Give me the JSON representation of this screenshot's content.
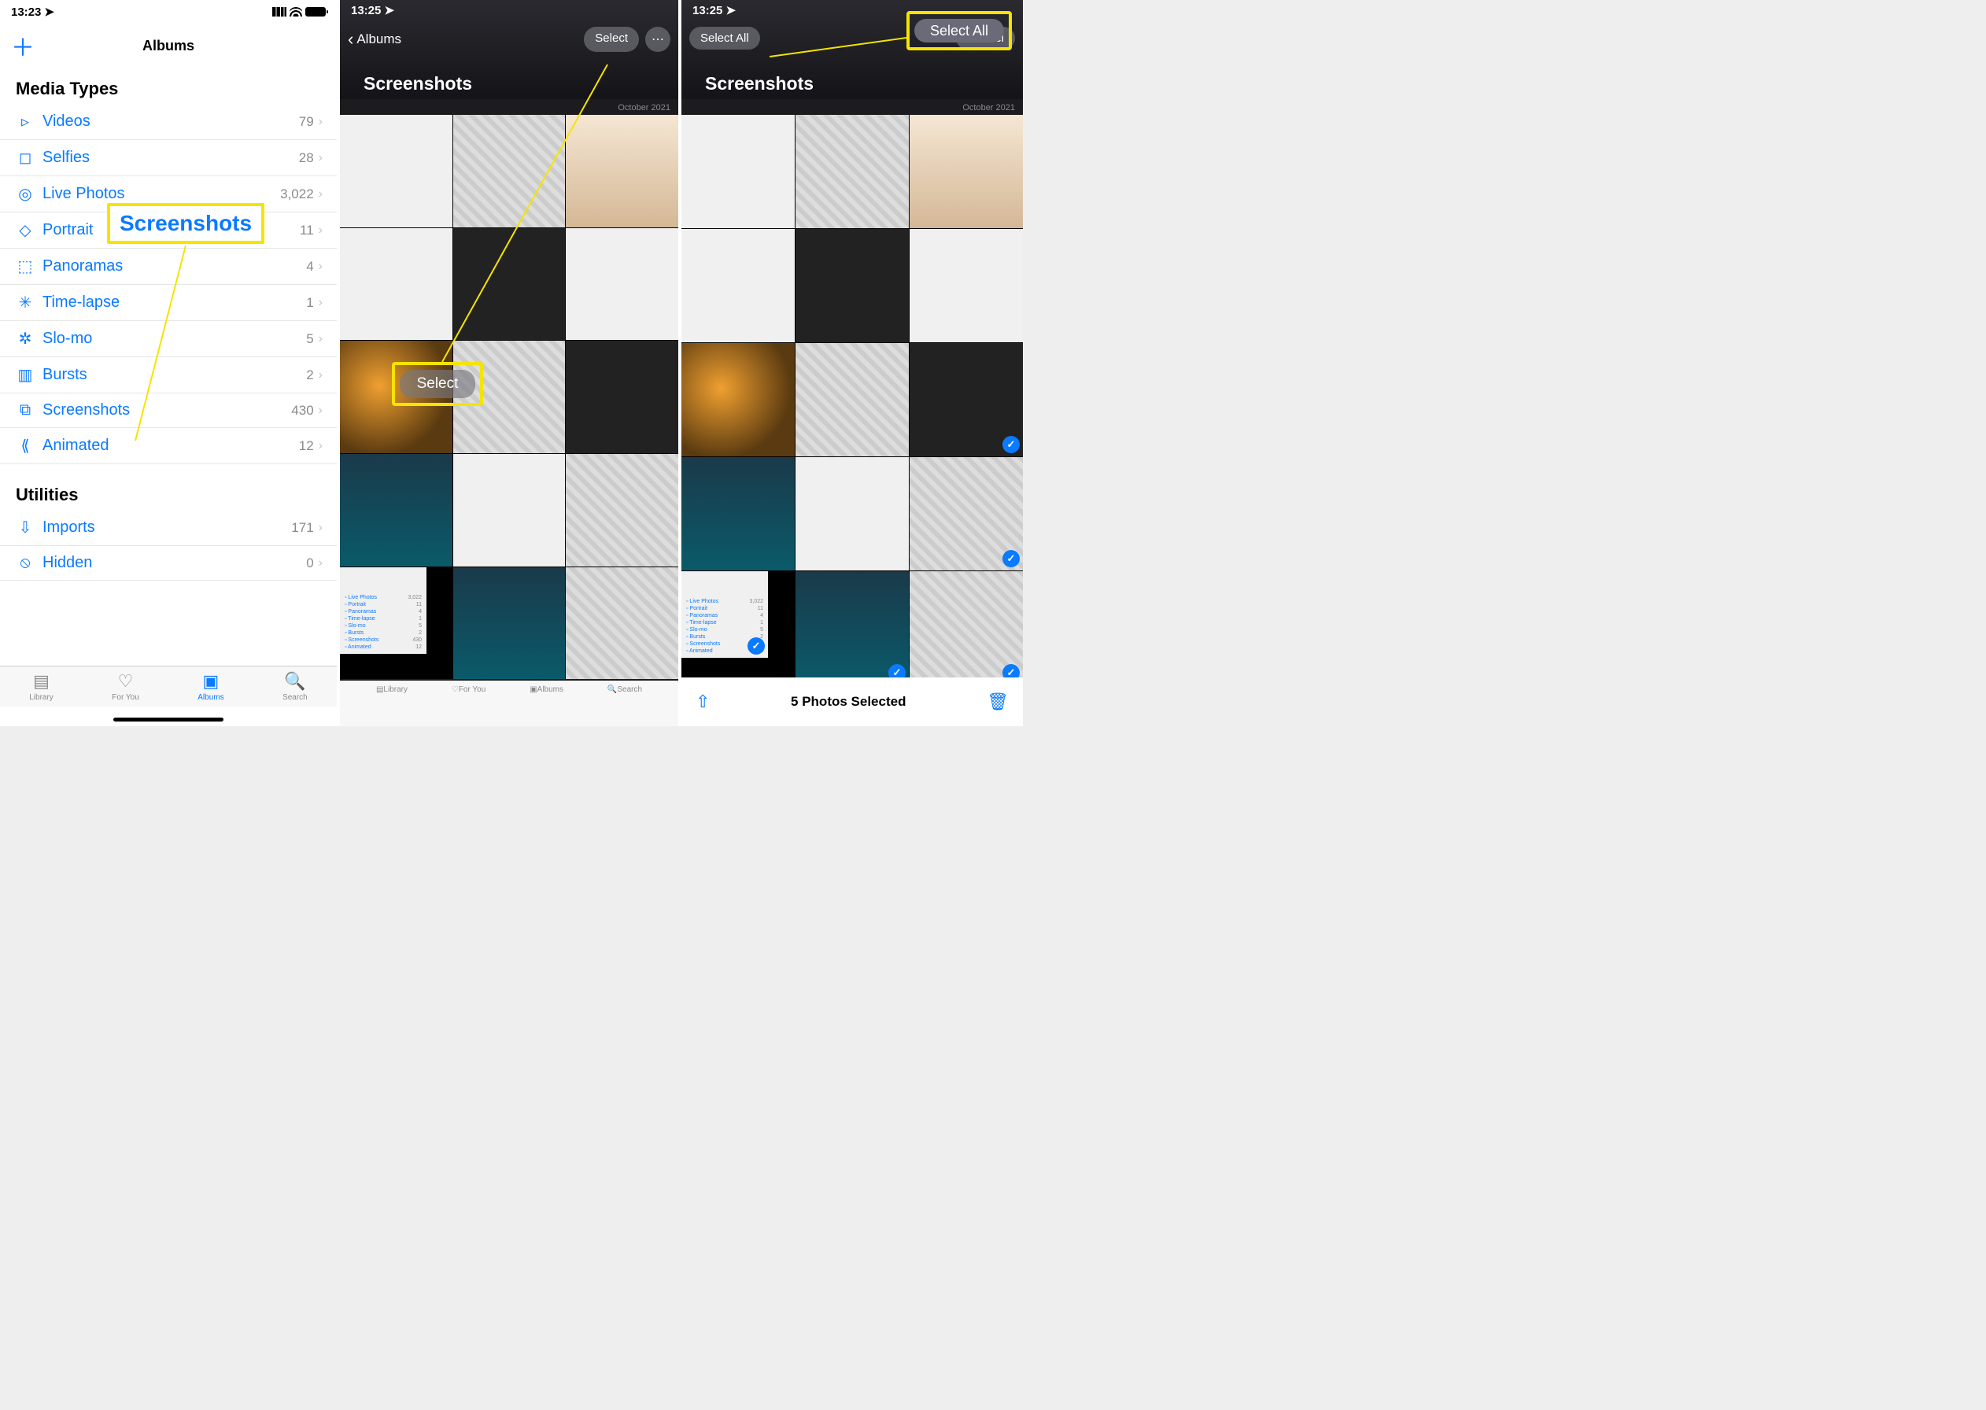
{
  "annotations": {
    "callout_screenshots": "Screenshots",
    "callout_select": "Select",
    "callout_selectall": "Select All"
  },
  "p1": {
    "time": "13:23",
    "header_title": "Albums",
    "section_media": "Media Types",
    "items": [
      {
        "icon": "▹",
        "label": "Videos",
        "count": "79"
      },
      {
        "icon": "◻",
        "label": "Selfies",
        "count": "28"
      },
      {
        "icon": "◎",
        "label": "Live Photos",
        "count": "3,022"
      },
      {
        "icon": "◇",
        "label": "Portrait",
        "count": "11"
      },
      {
        "icon": "⬚",
        "label": "Panoramas",
        "count": "4"
      },
      {
        "icon": "✳",
        "label": "Time-lapse",
        "count": "1"
      },
      {
        "icon": "✲",
        "label": "Slo-mo",
        "count": "5"
      },
      {
        "icon": "▥",
        "label": "Bursts",
        "count": "2"
      },
      {
        "icon": "⧉",
        "label": "Screenshots",
        "count": "430"
      },
      {
        "icon": "⟪",
        "label": "Animated",
        "count": "12"
      }
    ],
    "section_util": "Utilities",
    "util": [
      {
        "icon": "⇩",
        "label": "Imports",
        "count": "171"
      },
      {
        "icon": "⦸",
        "label": "Hidden",
        "count": "0"
      }
    ],
    "tabs": [
      "Library",
      "For You",
      "Albums",
      "Search"
    ]
  },
  "p2": {
    "time": "13:25",
    "back": "Albums",
    "title": "Screenshots",
    "select": "Select",
    "date": "October 2021",
    "tabs": [
      "Library",
      "For You",
      "Albums",
      "Search"
    ]
  },
  "p3": {
    "time": "13:25",
    "selectall": "Select All",
    "cancel": "Cancel",
    "title": "Screenshots",
    "date": "October 2021",
    "bottom": "5 Photos Selected"
  },
  "minilist": [
    "Live Photos",
    "Portrait",
    "Panoramas",
    "Time-lapse",
    "Slo-mo",
    "Bursts",
    "Screenshots",
    "Animated"
  ],
  "minilist_counts": [
    "3,022",
    "11",
    "4",
    "1",
    "5",
    "2",
    "430",
    "12"
  ]
}
